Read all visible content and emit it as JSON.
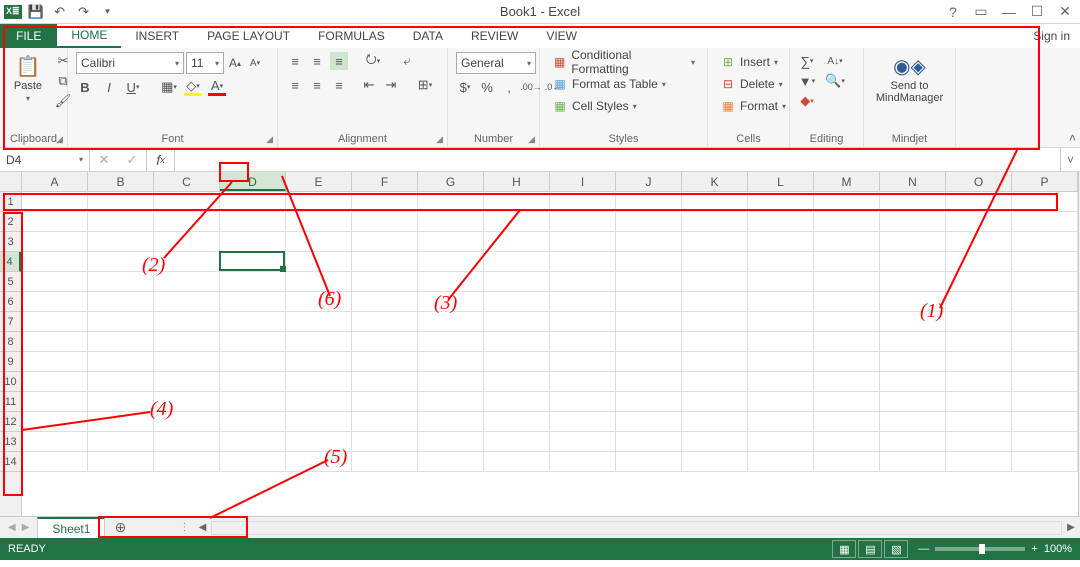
{
  "window": {
    "title": "Book1 - Excel",
    "sign_in": "Sign in"
  },
  "tabs": {
    "file": "FILE",
    "home": "HOME",
    "insert": "INSERT",
    "page_layout": "PAGE LAYOUT",
    "formulas": "FORMULAS",
    "data": "DATA",
    "review": "REVIEW",
    "view": "VIEW"
  },
  "ribbon": {
    "clipboard": {
      "label": "Clipboard",
      "paste": "Paste"
    },
    "font": {
      "label": "Font",
      "name": "Calibri",
      "size": "11"
    },
    "alignment": {
      "label": "Alignment"
    },
    "number": {
      "label": "Number",
      "format": "General"
    },
    "styles": {
      "label": "Styles",
      "cond": "Conditional Formatting",
      "table": "Format as Table",
      "cell": "Cell Styles"
    },
    "cells": {
      "label": "Cells",
      "insert": "Insert",
      "delete": "Delete",
      "format": "Format"
    },
    "editing": {
      "label": "Editing"
    },
    "mindjet": {
      "label": "Mindjet",
      "send1": "Send to",
      "send2": "MindManager"
    }
  },
  "namebox": "D4",
  "columns": [
    "A",
    "B",
    "C",
    "D",
    "E",
    "F",
    "G",
    "H",
    "I",
    "J",
    "K",
    "L",
    "M",
    "N",
    "O",
    "P"
  ],
  "rows": [
    "1",
    "2",
    "3",
    "4",
    "5",
    "6",
    "7",
    "8",
    "9",
    "10",
    "11",
    "12",
    "13",
    "14"
  ],
  "active": {
    "col": "D",
    "row": "4",
    "colIndex": 3,
    "rowIndex": 3
  },
  "sheet_tab": "Sheet1",
  "status": {
    "ready": "READY",
    "zoom": "100%"
  },
  "annotations": {
    "a1": "(1)",
    "a2": "(2)",
    "a3": "(3)",
    "a4": "(4)",
    "a5": "(5)",
    "a6": "(6)"
  }
}
